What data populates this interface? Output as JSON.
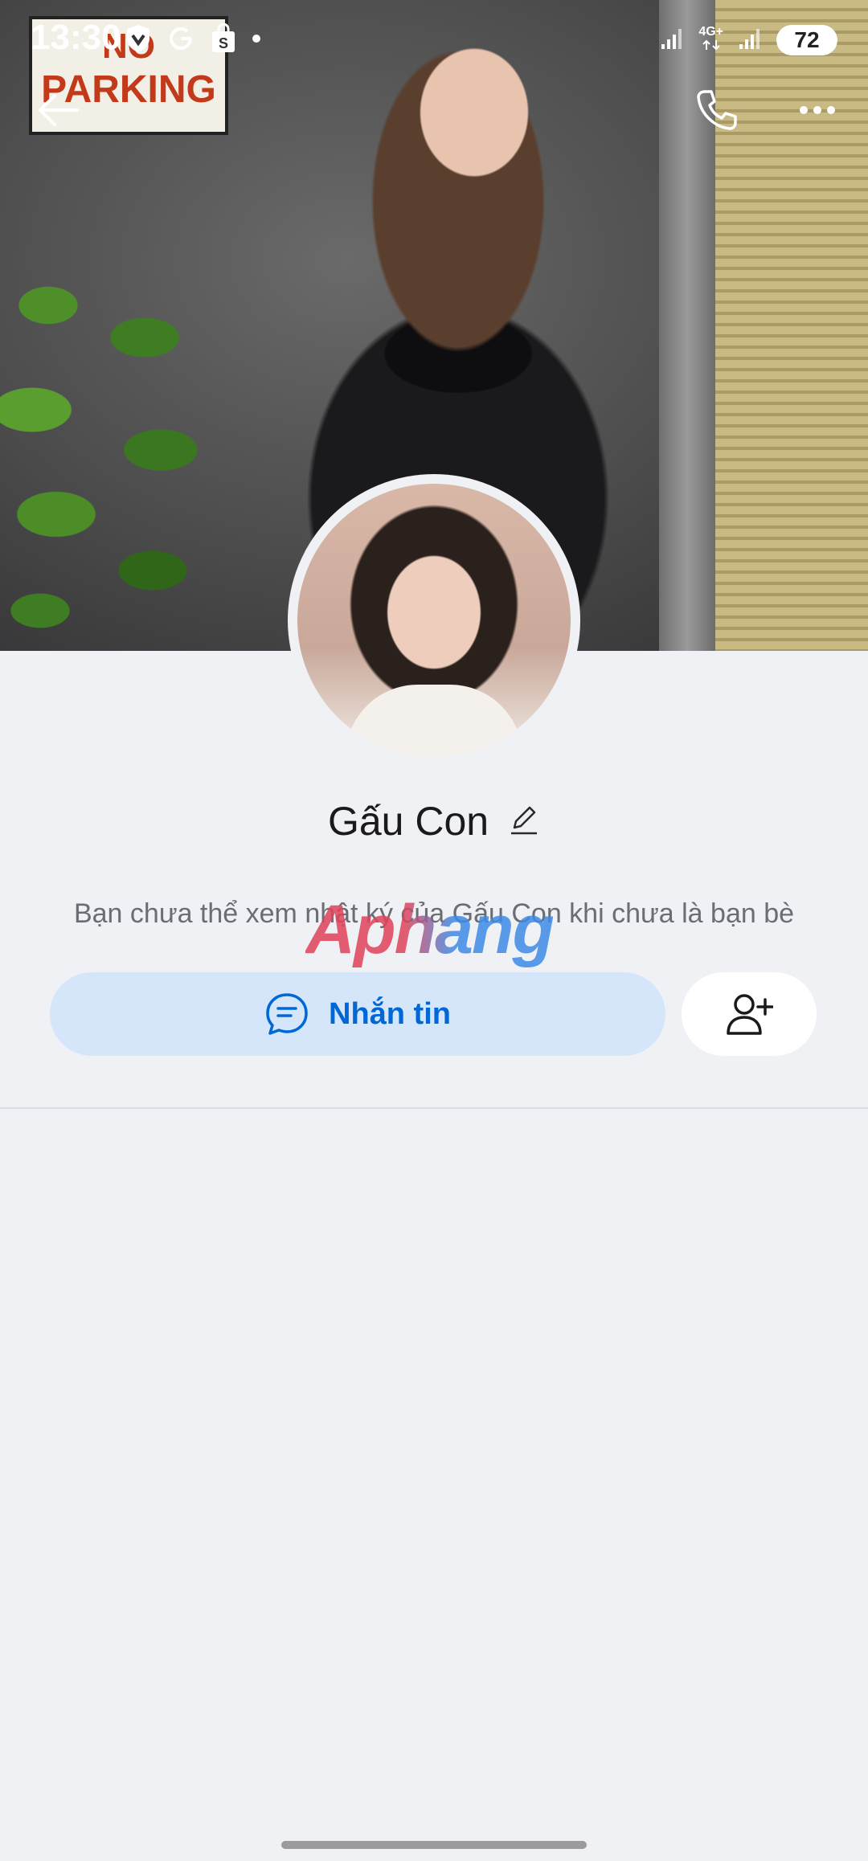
{
  "status_bar": {
    "time": "13:30",
    "network_label": "4G+",
    "battery": "72"
  },
  "cover": {
    "sign_line1": "NO",
    "sign_line2": "PARKING"
  },
  "profile": {
    "name": "Gấu Con",
    "info": "Bạn chưa thể xem nhật ký của Gấu Con khi chưa là bạn bè"
  },
  "actions": {
    "message_label": "Nhắn tin"
  },
  "watermark": {
    "text": "Aphang"
  },
  "colors": {
    "accent": "#0068d6",
    "accent_bg": "#d5e6fb",
    "background": "#f0f1f5"
  }
}
